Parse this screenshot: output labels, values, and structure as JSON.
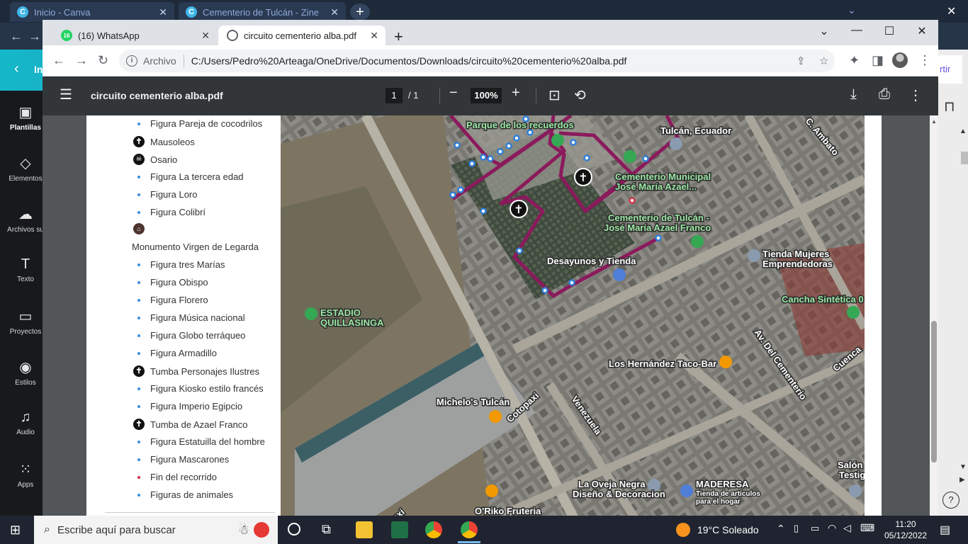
{
  "bg_browser": {
    "tabs": [
      {
        "label": "Inicio - Canva"
      },
      {
        "label": "Cementerio de Tulcán - Zine"
      }
    ],
    "canva_back_label": "In",
    "canva_share_label": "rtir",
    "sidebar": [
      {
        "label": "Plantillas",
        "icon": "templates-icon"
      },
      {
        "label": "Elementos",
        "icon": "elements-icon"
      },
      {
        "label": "Archivos su",
        "icon": "upload-icon"
      },
      {
        "label": "Texto",
        "icon": "text-icon"
      },
      {
        "label": "Proyectos",
        "icon": "folder-icon"
      },
      {
        "label": "Estilos",
        "icon": "palette-icon"
      },
      {
        "label": "Audio",
        "icon": "music-icon"
      },
      {
        "label": "Apps",
        "icon": "apps-icon"
      }
    ]
  },
  "browser": {
    "tabs": [
      {
        "label": "(16) WhatsApp",
        "badge": "16"
      },
      {
        "label": "circuito cementerio alba.pdf"
      }
    ],
    "address": {
      "scheme": "Archivo",
      "url": "C:/Users/Pedro%20Arteaga/OneDrive/Documentos/Downloads/circuito%20cementerio%20alba.pdf"
    }
  },
  "pdf": {
    "title": "circuito cementerio alba.pdf",
    "page_current": "1",
    "page_sep": "/  1",
    "zoom": "100%"
  },
  "legend": [
    {
      "type": "dot",
      "label": "Figura Pareja de cocodrilos"
    },
    {
      "type": "cross",
      "label": "Mausoleos"
    },
    {
      "type": "skull",
      "label": "Osario"
    },
    {
      "type": "dot",
      "label": "Figura La tercera edad"
    },
    {
      "type": "dot",
      "label": "Figura Loro"
    },
    {
      "type": "dot",
      "label": "Figura Colibrí"
    },
    {
      "type": "monument",
      "label": ""
    },
    {
      "type": "none",
      "label": "Monumento Virgen de Legarda"
    },
    {
      "type": "dot",
      "label": "Figura tres Marías"
    },
    {
      "type": "dot",
      "label": "Figura Obispo"
    },
    {
      "type": "dot",
      "label": "Figura Florero"
    },
    {
      "type": "dot",
      "label": "Figura Música nacional"
    },
    {
      "type": "dot",
      "label": "Figura Globo terráqueo"
    },
    {
      "type": "dot",
      "label": "Figura Armadillo"
    },
    {
      "type": "cross",
      "label": "Tumba Personajes Ilustres"
    },
    {
      "type": "dot",
      "label": "Figura Kiosko estilo francés"
    },
    {
      "type": "dot",
      "label": "Figura Imperio Egipcio"
    },
    {
      "type": "cross",
      "label": "Tumba de Azael Franco"
    },
    {
      "type": "dot",
      "label": "Figura Estatuilla del hombre"
    },
    {
      "type": "dot",
      "label": "Figura Mascarones"
    },
    {
      "type": "red",
      "label": "Fin del recorrido"
    },
    {
      "type": "dot",
      "label": "Figuras de animales"
    }
  ],
  "map_labels": {
    "parque": "Parque de los recuerdos",
    "tulcan": "Tulcán, Ecuador",
    "ambato": "C. Ambato",
    "cem_municipal_1": "Cementerio Municipal",
    "cem_municipal_2": "José María Azael...",
    "cem_tulcan_1": "Cementerio de Tulcán -",
    "cem_tulcan_2": "José María Azael Franco",
    "tienda_1": "Tienda Mujeres",
    "tienda_2": "Emprendedoras",
    "desayunos": "Desayunos y Tienda",
    "estadio_1": "ESTADIO",
    "estadio_2": "QUILLASINGA",
    "cancha": "Cancha Sintética 0",
    "av_cementerio": "Av. Del Cementerio",
    "hernandez": "Los Hernández Taco-Bar",
    "cuenca": "Cuenca",
    "michelos": "Michelo's Tulcán",
    "cotopaxi": "Cotopaxi",
    "venezuela": "Venezuela",
    "salon_1": "Salón",
    "salon_2": "Testig",
    "oveja_1": "La Oveja Negra",
    "oveja_2": "Diseño & Decoracion",
    "maderesa": "MADERESA",
    "maderesa_sub_1": "Tienda de artículos",
    "maderesa_sub_2": "para el hogar",
    "oriko": "O'Riko Fruteria",
    "paxi": "paxi"
  },
  "taskbar": {
    "search_placeholder": "Escribe aquí para buscar",
    "weather": "19°C  Soleado",
    "time": "11:20",
    "date": "05/12/2022"
  },
  "colors": {
    "route": "#8b1a5c",
    "stop_dot": "#2f7fd8",
    "end_dot": "#d2344b",
    "pdf_toolbar": "#323639"
  }
}
